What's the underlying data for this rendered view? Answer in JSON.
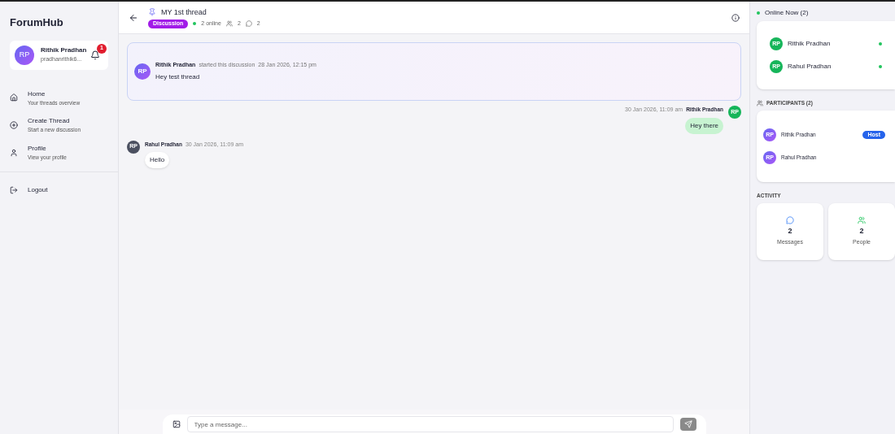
{
  "sidebar": {
    "brand": "ForumHub",
    "user": {
      "initials": "RP",
      "name": "Rithik Pradhan",
      "email": "pradhanrithik6...",
      "notifications": "1"
    },
    "nav": [
      {
        "label": "Home",
        "sub": "Your threads overview"
      },
      {
        "label": "Create Thread",
        "sub": "Start a new discussion"
      },
      {
        "label": "Profile",
        "sub": "View your profile"
      }
    ],
    "logout": "Logout"
  },
  "header": {
    "title": "MY 1st thread",
    "tag": "Discussion",
    "online": "2 online",
    "people": "2",
    "messages": "2"
  },
  "opening": {
    "initials": "RP",
    "author": "Rithik Pradhan",
    "action": "started this discussion",
    "time": "28 Jan 2026, 12:15 pm",
    "text": "Hey test thread"
  },
  "messages": [
    {
      "kind": "mine",
      "initials": "RP",
      "author": "Rithik Pradhan",
      "time": "30 Jan 2026, 11:09 am",
      "text": "Hey there"
    },
    {
      "kind": "other",
      "initials": "RP",
      "author": "Rahul Pradhan",
      "time": "30 Jan 2026, 11:09 am",
      "text": "Hello"
    }
  ],
  "composer": {
    "placeholder": "Type a message..."
  },
  "right": {
    "online_title": "Online Now (2)",
    "online": [
      {
        "initials": "RP",
        "name": "Rithik Pradhan",
        "online": true
      },
      {
        "initials": "RP",
        "name": "Rahul Pradhan",
        "online": true
      }
    ],
    "participants_title": "PARTICIPANTS (2)",
    "participants": [
      {
        "initials": "RP",
        "name": "Rithik Pradhan",
        "badge": "Host"
      },
      {
        "initials": "RP",
        "name": "Rahul Pradhan"
      }
    ],
    "activity_title": "ACTIVITY",
    "activity": [
      {
        "value": "2",
        "label": "Messages"
      },
      {
        "value": "2",
        "label": "People"
      }
    ]
  }
}
